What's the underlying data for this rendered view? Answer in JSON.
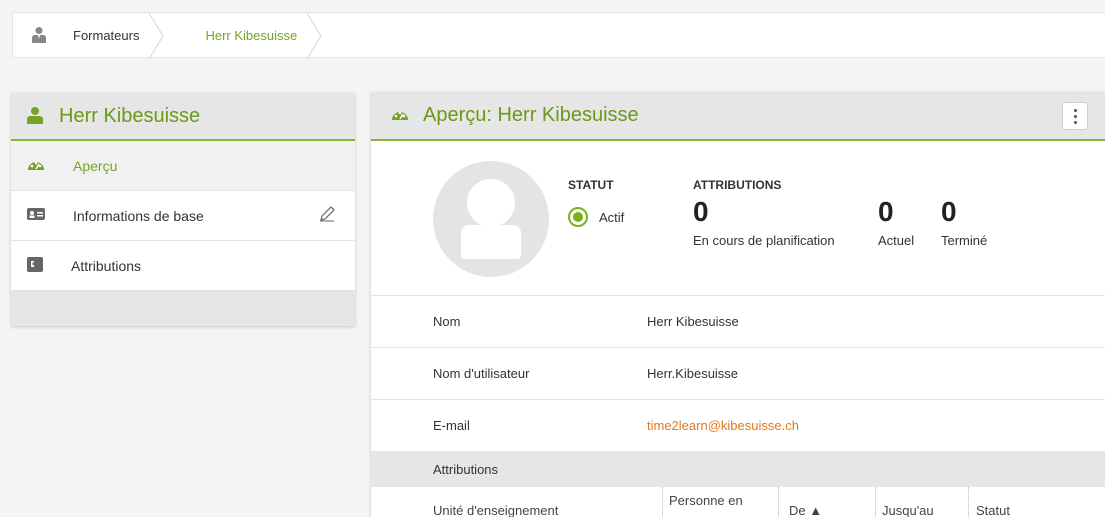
{
  "breadcrumb": {
    "items": [
      "Formateurs",
      "Herr Kibesuisse"
    ]
  },
  "left_panel": {
    "title": "Herr Kibesuisse",
    "items": [
      {
        "label": "Aperçu",
        "icon": "dashboard-icon",
        "selected": true
      },
      {
        "label": "Informations de base",
        "icon": "id-card-icon"
      },
      {
        "label": "Attributions",
        "icon": "assignment-icon"
      }
    ]
  },
  "right_panel": {
    "title": "Aperçu: Herr Kibesuisse",
    "statut_heading": "STATUT",
    "statut_value": "Actif",
    "attributions_heading": "ATTRIBUTIONS",
    "stats": [
      {
        "value": "0",
        "label": "En cours de planification"
      },
      {
        "value": "0",
        "label": "Actuel"
      },
      {
        "value": "0",
        "label": "Terminé"
      }
    ],
    "fields": [
      {
        "key": "Nom",
        "value": "Herr Kibesuisse"
      },
      {
        "key": "Nom d'utilisateur",
        "value": "Herr.Kibesuisse"
      },
      {
        "key": "E-mail",
        "value": "time2learn@kibesuisse.ch"
      }
    ],
    "section_title": "Attributions",
    "table_headers": [
      "Unité d'enseignement",
      "Personne en",
      "De ▲",
      "Jusqu'au",
      "Statut"
    ]
  },
  "colors": {
    "accent": "#76a225",
    "link": "#e07a1f",
    "panel_header_bg": "#e6e6e6"
  }
}
